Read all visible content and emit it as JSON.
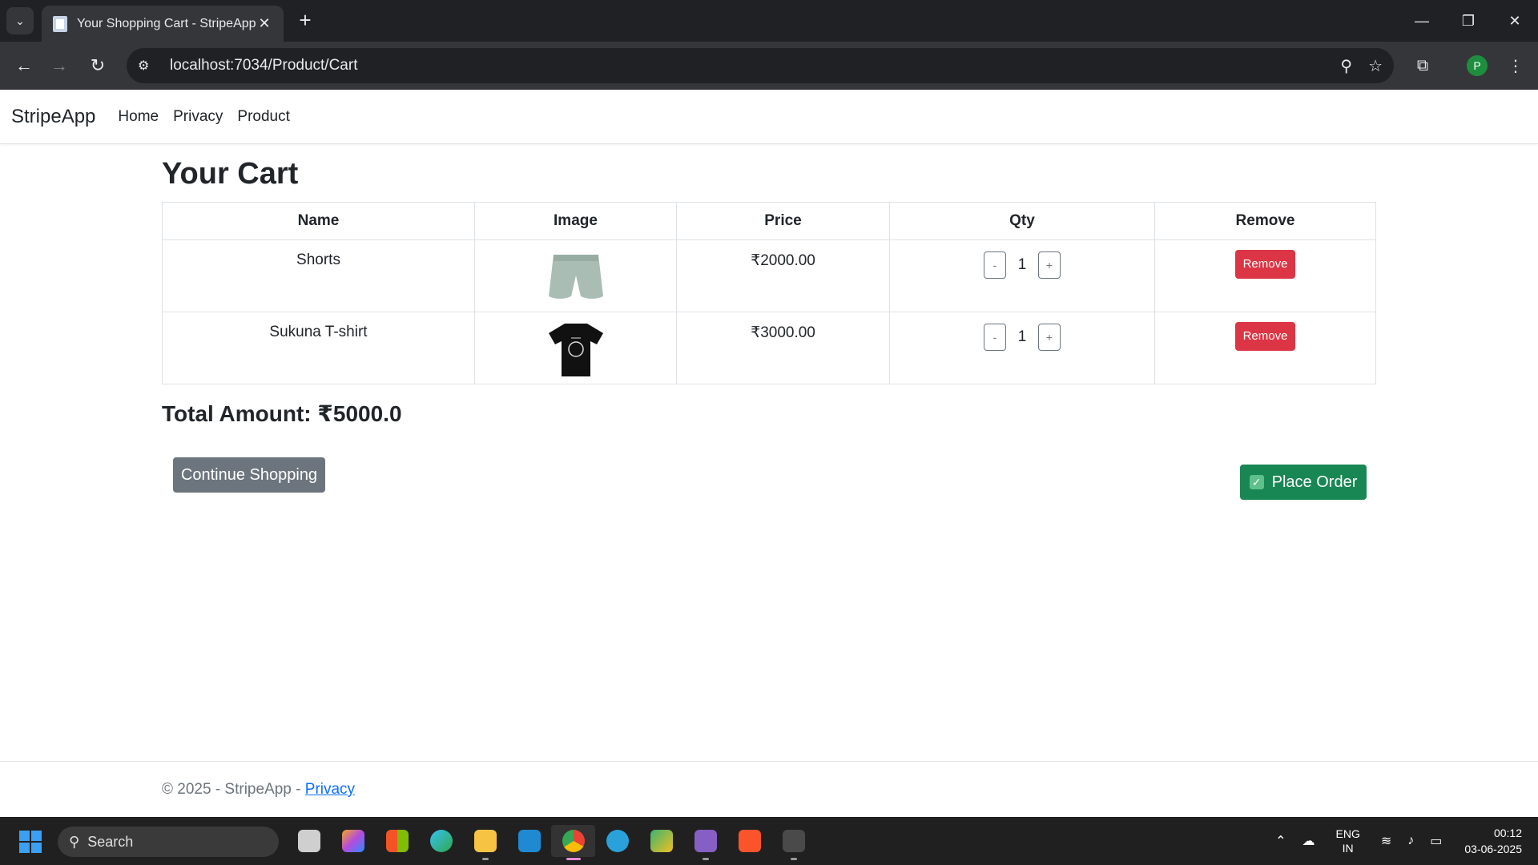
{
  "browser": {
    "tab_title": "Your Shopping Cart - StripeApp",
    "url": "localhost:7034/Product/Cart",
    "profile_initial": "P"
  },
  "nav": {
    "brand": "StripeApp",
    "links": [
      "Home",
      "Privacy",
      "Product"
    ]
  },
  "cart": {
    "title": "Your Cart",
    "headers": [
      "Name",
      "Image",
      "Price",
      "Qty",
      "Remove"
    ],
    "items": [
      {
        "name": "Shorts",
        "image": "shorts-image",
        "price": "₹2000.00",
        "qty": "1",
        "remove_label": "Remove"
      },
      {
        "name": "Sukuna T-shirt",
        "image": "tshirt-image",
        "price": "₹3000.00",
        "qty": "1",
        "remove_label": "Remove"
      }
    ],
    "qty_minus": "-",
    "qty_plus": "+",
    "total": "Total Amount: ₹5000.0",
    "continue_label": "Continue Shopping",
    "place_order_label": "Place Order"
  },
  "footer": {
    "text": "© 2025 - StripeApp - ",
    "link": "Privacy"
  },
  "taskbar": {
    "search_label": "Search",
    "lang_top": "ENG",
    "lang_bottom": "IN",
    "time": "00:12",
    "date": "03-06-2025"
  },
  "colors": {
    "danger": "#dc3545",
    "success": "#198754",
    "secondary": "#6c757d",
    "link": "#0d6efd"
  }
}
